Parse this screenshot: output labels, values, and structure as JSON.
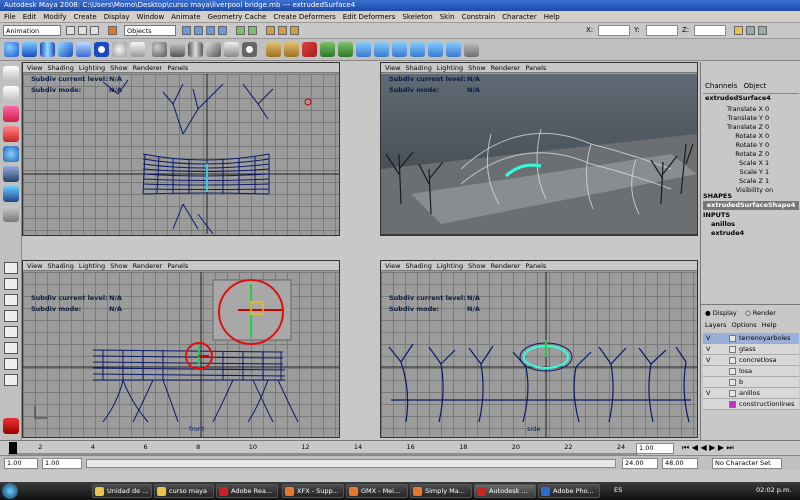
{
  "window": {
    "title": "Autodesk Maya 2008: C:\\Users\\Momo\\Desktop\\curso maya\\liverpool bridge.mb    ---    extrudedSurface4"
  },
  "menu": [
    "File",
    "Edit",
    "Modify",
    "Create",
    "Display",
    "Window",
    "Animate",
    "Geometry Cache",
    "Create Deformers",
    "Edit Deformers",
    "Skeleton",
    "Skin",
    "Constrain",
    "Character",
    "Help"
  ],
  "status": {
    "menu_set": "Animation",
    "selection_mode": "Objects",
    "x_label": "X:",
    "y_label": "Y:",
    "z_label": "Z:"
  },
  "panel_menu": [
    "View",
    "Shading",
    "Lighting",
    "Show",
    "Renderer",
    "Panels"
  ],
  "hud": {
    "level_label": "Subdiv current level:",
    "level_value": "N/A",
    "mode_label": "Subdiv mode:",
    "mode_value": "N/A"
  },
  "viewports": {
    "front_label": "front",
    "side_label": "side"
  },
  "channel_box": {
    "tabs": [
      "Channels",
      "Object"
    ],
    "object_name": "extrudedSurface4",
    "attributes": [
      {
        "name": "Translate X",
        "value": "0"
      },
      {
        "name": "Translate Y",
        "value": "0"
      },
      {
        "name": "Translate Z",
        "value": "0"
      },
      {
        "name": "Rotate X",
        "value": "0"
      },
      {
        "name": "Rotate Y",
        "value": "0"
      },
      {
        "name": "Rotate Z",
        "value": "0"
      },
      {
        "name": "Scale X",
        "value": "1"
      },
      {
        "name": "Scale Y",
        "value": "1"
      },
      {
        "name": "Scale Z",
        "value": "1"
      },
      {
        "name": "Visibility",
        "value": "on"
      }
    ],
    "shapes_header": "SHAPES",
    "shape_name": "extrudedSurfaceShape4",
    "inputs_header": "INPUTS",
    "inputs": [
      "anillos",
      "extrude4"
    ]
  },
  "layer_editor": {
    "display_option": "Display",
    "render_option": "Render",
    "menu": [
      "Layers",
      "Options",
      "Help"
    ],
    "layers": [
      {
        "v": "V",
        "name": "terrenoyarboles",
        "selected": true
      },
      {
        "v": "V",
        "name": "glass",
        "selected": false
      },
      {
        "v": "V",
        "name": "concretlosa",
        "selected": false
      },
      {
        "v": "",
        "name": "losa",
        "selected": false
      },
      {
        "v": "",
        "name": "b",
        "selected": false
      },
      {
        "v": "V",
        "name": "anillos",
        "selected": false
      },
      {
        "v": "",
        "name": "constructionlines",
        "selected": false
      }
    ]
  },
  "timeline": {
    "ticks": [
      "1",
      "2",
      "4",
      "6",
      "8",
      "10",
      "12",
      "14",
      "16",
      "18",
      "20",
      "22",
      "24"
    ],
    "current_frame": "1.00"
  },
  "range": {
    "start": "1.00",
    "inner_start": "1.00",
    "inner_end": "24.00",
    "end": "48.00",
    "character_set": "No Character Set"
  },
  "taskbar": {
    "items": [
      "Unidad de ...",
      "curso maya",
      "Adobe Rea...",
      "XFX - Supp...",
      "GMX - Mei...",
      "Simply Ma...",
      "Autodesk ...",
      "Adobe Pho..."
    ],
    "lang": "ES",
    "clock": "02:02 p.m."
  }
}
